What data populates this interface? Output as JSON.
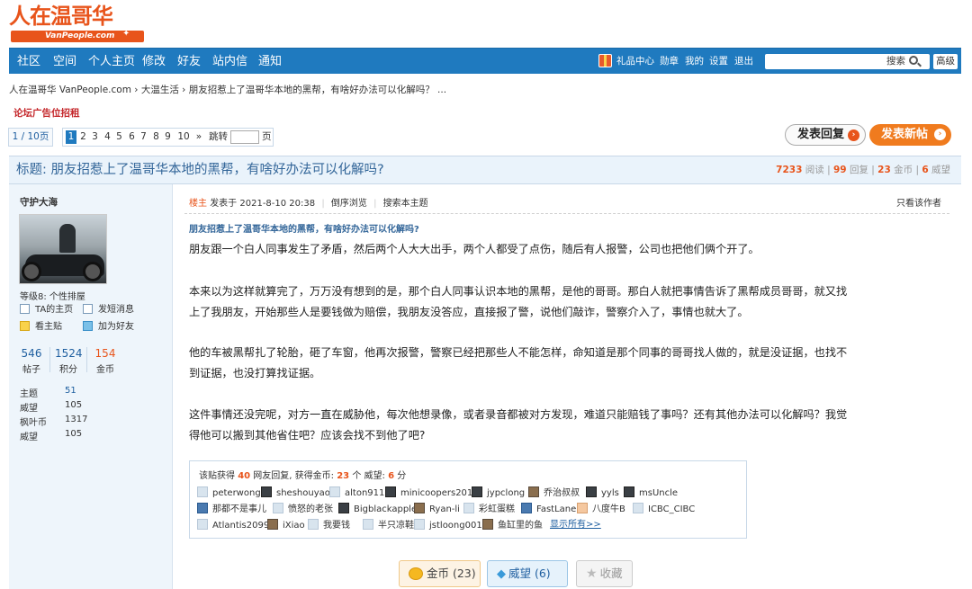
{
  "logo": {
    "main": "人在温哥华",
    "sub": "VanPeople.com"
  },
  "nav": {
    "items": [
      "社区",
      "空间",
      "个人主页",
      "修改",
      "好友",
      "站内信",
      "通知"
    ],
    "right": [
      "礼品中心",
      "勋章",
      "我的",
      "设置",
      "退出"
    ],
    "search_label": "搜索",
    "advanced": "高级"
  },
  "breadcrumb": "人在温哥华 VanPeople.com › 大温生活 › 朋友招惹上了温哥华本地的黑帮，有啥好办法可以化解吗？ ...",
  "ad_link": "论坛广告位招租",
  "pagination": {
    "info": "1 / 10页",
    "pages": [
      "1",
      "2",
      "3",
      "4",
      "5",
      "6",
      "7",
      "8",
      "9",
      "10",
      "»"
    ],
    "jump_label": "跳转",
    "jump_suffix": "页"
  },
  "buttons": {
    "reply": "发表回复",
    "new_post": "发表新帖"
  },
  "thread": {
    "title": "标题: 朋友招惹上了温哥华本地的黑帮，有啥好办法可以化解吗?",
    "views": "7233",
    "views_label": "阅读",
    "replies": "99",
    "replies_label": "回复",
    "coins": "23",
    "coins_label": "金币",
    "prestige": "6",
    "prestige_label": "威望"
  },
  "author": {
    "name": "守护大海",
    "level": "等级8: 个性排屋",
    "actions": [
      "TA的主页",
      "发短消息",
      "看主贴",
      "加为好友"
    ],
    "stats": [
      {
        "value": "546",
        "label": "帖子"
      },
      {
        "value": "1524",
        "label": "积分"
      },
      {
        "value": "154",
        "label": "金币"
      }
    ],
    "details": [
      {
        "k": "主题",
        "v": "51"
      },
      {
        "k": "威望",
        "v": "105"
      },
      {
        "k": "枫叶币",
        "v": "1317"
      },
      {
        "k": "威望",
        "v": "105"
      }
    ]
  },
  "post": {
    "floor": "楼主",
    "posted": "发表于 2021-8-10 20:38",
    "reverse": "倒序浏览",
    "search_topic": "搜索本主题",
    "only_author": "只看该作者",
    "title": "朋友招惹上了温哥华本地的黑帮，有啥好办法可以化解吗?",
    "paragraphs": [
      "朋友跟一个白人同事发生了矛盾，然后两个人大大出手，两个人都受了点伤，随后有人报警，公司也把他们俩个开了。",
      "本来以为这样就算完了，万万没有想到的是，那个白人同事认识本地的黑帮，是他的哥哥。那白人就把事情告诉了黑帮成员哥哥，就又找上了我朋友，开始那些人是要钱做为赔偿，我朋友没答应，直接报了警，说他们敲诈，警察介入了，事情也就大了。",
      "他的车被黑帮扎了轮胎，砸了车窗，他再次报警，警察已经把那些人不能怎样，命知道是那个同事的哥哥找人做的，就是没证据，也找不到证据，也没打算找证据。",
      "这件事情还没完呢，对方一直在威胁他，每次他想录像，或者录音都被对方发现，难道只能赔钱了事吗？还有其他办法可以化解吗？我觉得他可以搬到其他省住吧？应该会找不到他了吧?"
    ]
  },
  "rating": {
    "prefix": "该贴获得",
    "count": "40",
    "mid1": "网友回复, 获得金币:",
    "coins": "23",
    "mid2": "个 威望:",
    "prestige": "6",
    "suffix": "分",
    "users": [
      [
        "peterwong",
        "sheshouyao",
        "alton911",
        "minicoopers2015",
        "jypclong",
        "乔治叔叔",
        "yyls",
        "msUncle"
      ],
      [
        "那都不是事儿",
        "愤怒的老张",
        "Bigblackapple",
        "Ryan-li",
        "彩虹蛋糕",
        "FastLane",
        "八度牛B",
        "ICBC_CIBC"
      ],
      [
        "Atlantis2099",
        "iXiao",
        "我要钱",
        "半只凉鞋",
        "jstloong001",
        "鱼缸里的鱼"
      ]
    ],
    "show_all": "显示所有>>"
  },
  "bottom": {
    "coin": "金币 (23)",
    "prestige": "威望 (6)",
    "favorite": "收藏"
  },
  "colors": {
    "nav_bg": "#1f7abf",
    "accent_orange": "#e8541b",
    "title_blue": "#336699"
  }
}
